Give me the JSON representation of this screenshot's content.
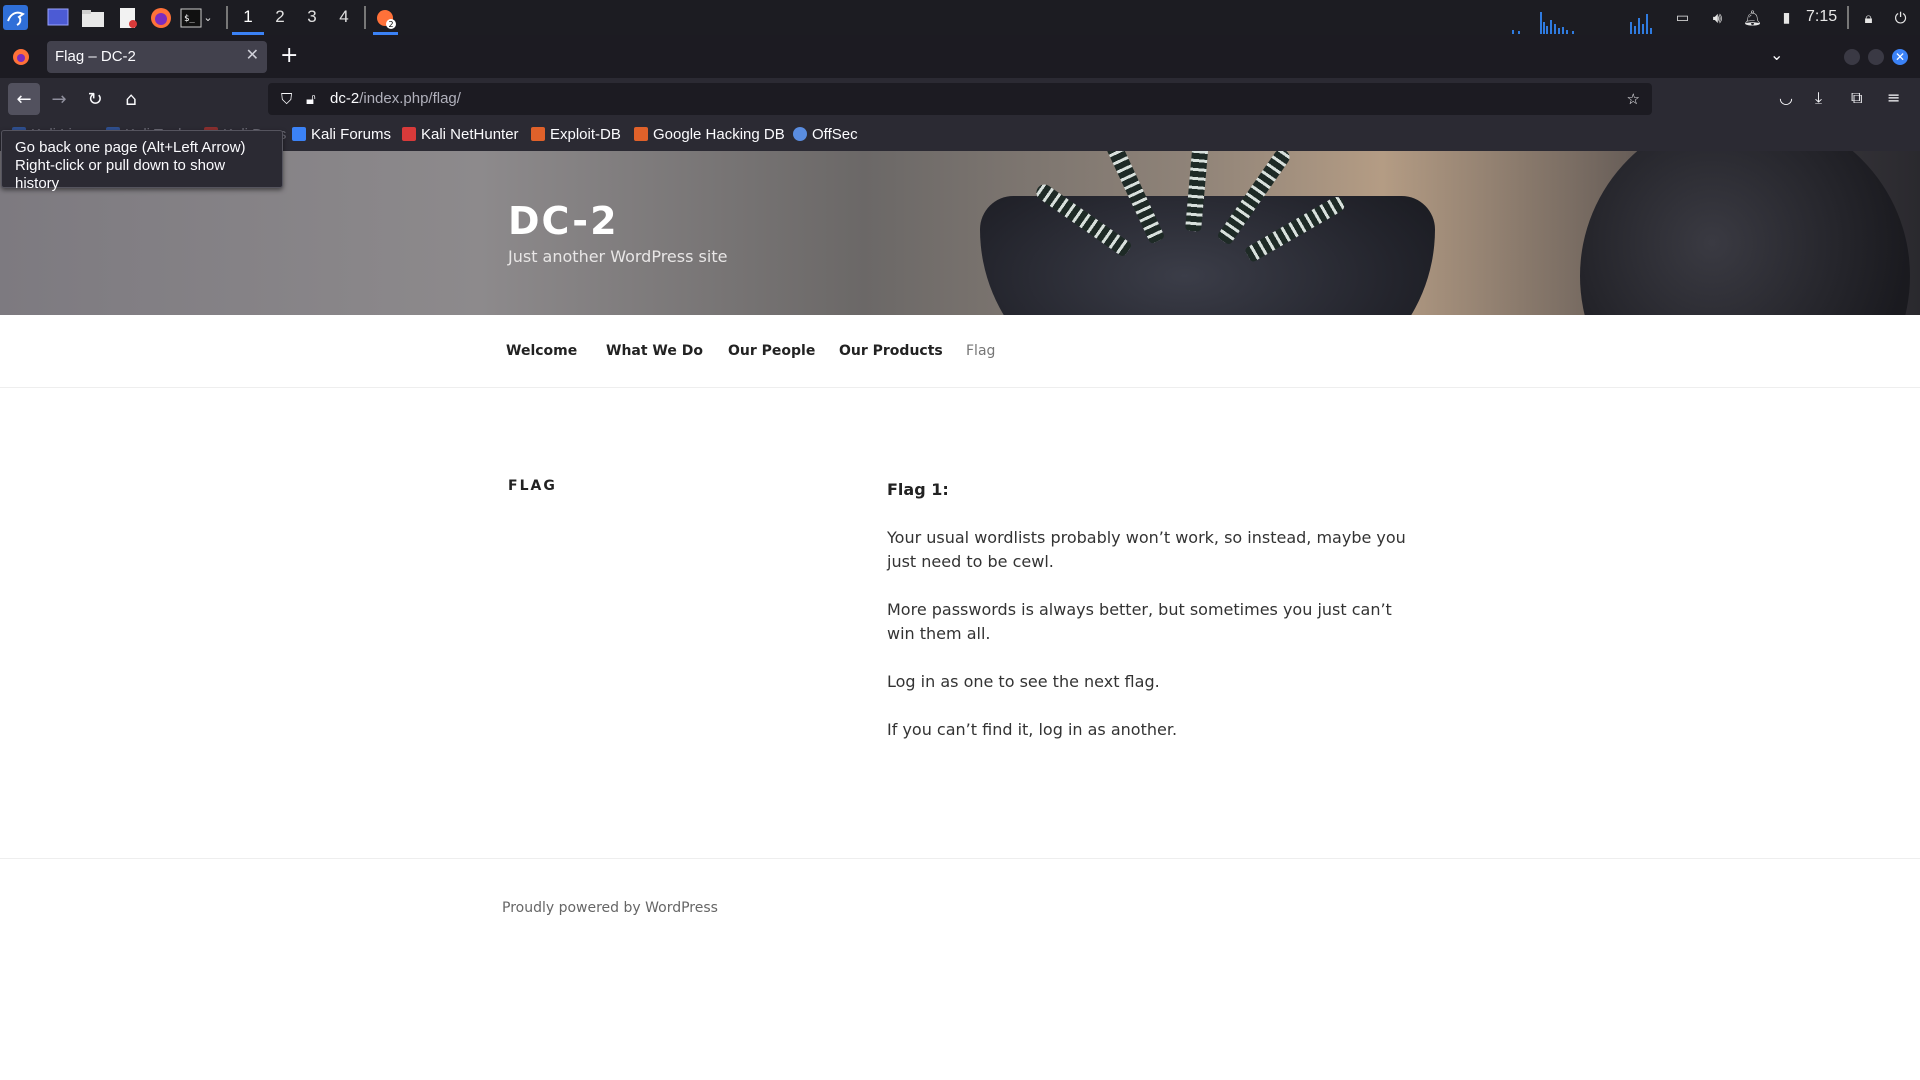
{
  "taskbar": {
    "workspaces": [
      "1",
      "2",
      "3",
      "4"
    ],
    "time": "7:15",
    "icons": [
      "kali-menu-icon",
      "desktop-icon",
      "file-manager-icon",
      "text-editor-icon",
      "firefox-icon",
      "terminal-icon"
    ]
  },
  "browser": {
    "tab_title": "Flag – DC-2",
    "url_host": "dc-2",
    "url_path": "/index.php/flag/",
    "tooltip_line1": "Go back one page (Alt+Left Arrow)",
    "tooltip_line2": "Right-click or pull down to show history",
    "bookmarks": [
      "Kali Linux",
      "Kali Tools",
      "Kali Docs",
      "Kali Forums",
      "Kali NetHunter",
      "Exploit-DB",
      "Google Hacking DB",
      "OffSec"
    ]
  },
  "site": {
    "title": "DC-2",
    "description": "Just another WordPress site",
    "menu": [
      "Welcome",
      "What We Do",
      "Our People",
      "Our Products",
      "Flag"
    ],
    "page_title": "FLAG",
    "content": {
      "heading": "Flag 1:",
      "p1": "Your usual wordlists probably won’t work, so instead, maybe you just need to be cewl.",
      "p2": "More passwords is always better, but sometimes you just can’t win them all.",
      "p3": "Log in as one to see the next flag.",
      "p4": "If you can’t find it, log in as another."
    },
    "footer": "Proudly powered by WordPress"
  },
  "colors": {
    "taskbar_bg": "#1c1c22",
    "browser_bg": "#2b2a33",
    "accent": "#3b82f6"
  }
}
